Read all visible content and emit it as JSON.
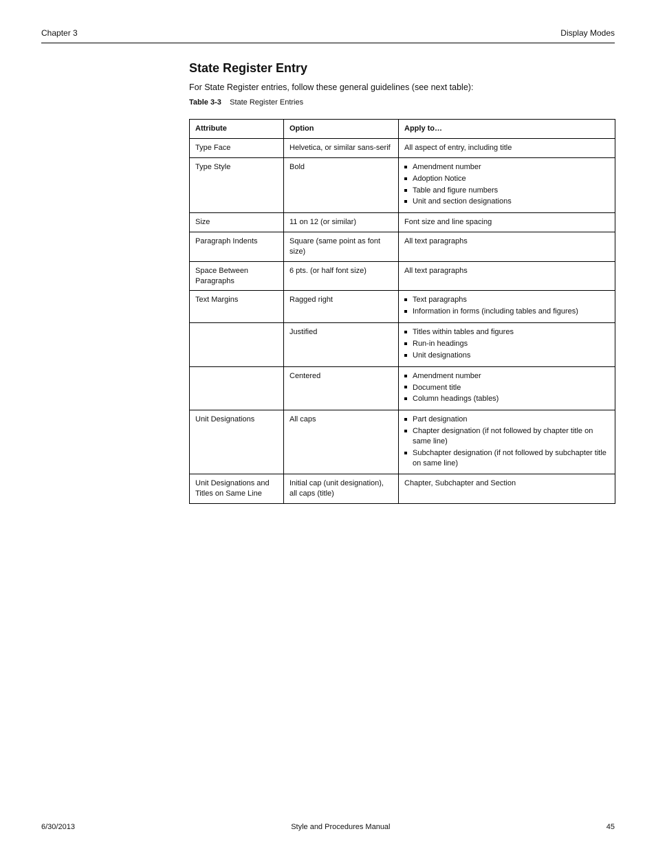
{
  "header": {
    "chapter": "Chapter 3",
    "subject": "Display Modes"
  },
  "section": {
    "title": "State Register Entry",
    "lead": "For State Register entries, follow these general guidelines (see next table):",
    "table_caption_label": "Table 3-3",
    "table_caption_text": "State Register Entries"
  },
  "table": {
    "headers": [
      "Attribute",
      "Option",
      "Apply to…"
    ],
    "rows": [
      {
        "attr": "Type Face",
        "opt": "Helvetica, or similar sans-serif",
        "desc": "All aspect of entry, including title"
      },
      {
        "attr": "Type Style",
        "opt": "Bold",
        "bullets": [
          "Amendment number",
          "Adoption Notice",
          "Table and figure numbers",
          "Unit and section designations"
        ]
      },
      {
        "attr": "Size",
        "opt": "11 on 12 (or similar)",
        "desc": "Font size and line spacing"
      },
      {
        "attr": "Paragraph Indents",
        "opt": "Square (same point as font size)",
        "desc": "All text paragraphs"
      },
      {
        "attr": "Space Between Paragraphs",
        "opt": "6 pts. (or half font size)",
        "desc": "All text paragraphs"
      },
      {
        "attr": "Text Margins",
        "opt": "Ragged right",
        "bullets": [
          "Text paragraphs",
          "Information in forms (including tables and figures)"
        ]
      },
      {
        "attr": "",
        "opt": "Justified",
        "bullets": [
          "Titles within tables and figures",
          "Run-in headings",
          "Unit designations"
        ]
      },
      {
        "attr": "",
        "opt": "Centered",
        "bullets": [
          "Amendment number",
          "Document title",
          "Column headings (tables)"
        ]
      },
      {
        "attr": "Unit Designations",
        "opt": "All caps",
        "bullets": [
          "Part designation",
          "Chapter designation (if not followed by chapter title on same line)",
          "Subchapter designation (if not followed by subchapter title on same line)"
        ]
      },
      {
        "attr": "Unit Designations and Titles on Same Line",
        "opt": "Initial cap (unit designation), all caps (title)",
        "desc": "Chapter, Subchapter and Section"
      }
    ]
  },
  "footer": {
    "date": "6/30/2013",
    "center": "Style and Procedures Manual",
    "page": "45"
  }
}
